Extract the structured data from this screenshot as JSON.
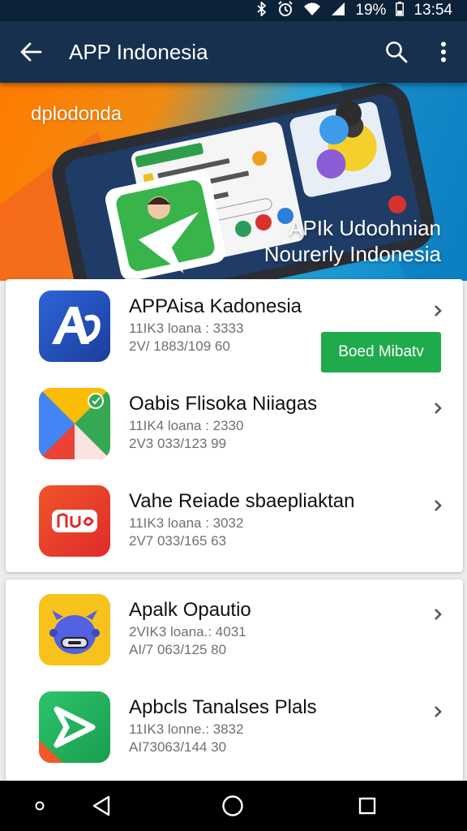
{
  "status_bar": {
    "battery": "19%",
    "time": "13:54",
    "icons": [
      "bluetooth-icon",
      "alarm-icon",
      "wifi-icon",
      "signal-icon",
      "battery-icon"
    ]
  },
  "app_bar": {
    "title": "APP Indonesia",
    "back_icon": "arrow-left-icon",
    "search_icon": "search-icon",
    "menu_icon": "more-vert-icon"
  },
  "banner": {
    "tagline": "dplodonda",
    "headline_line1": "APIk Udoohnian",
    "headline_line2": "Nourerly Indonesia"
  },
  "card1": {
    "apps": [
      {
        "name": "APPAisa Kadonesia",
        "meta1": "11IK3 loana :  3333",
        "meta2": "2V/ 1883/109 60",
        "install_label": "Boed Mibatv",
        "icon": "app-a-icon",
        "colors": [
          "#1b3f9c",
          "#2e63d8"
        ]
      },
      {
        "name": "Oabis Flisoka Niiagas",
        "meta1": "11IK4 loana :  2330",
        "meta2": "2V3 033/123 99",
        "icon": "play-triangle-icon"
      },
      {
        "name": "Vahe Reiade sbaepliaktan",
        "meta1": "11IK3 loana :  3032",
        "meta2": "2V7 033/165 63",
        "icon": "nu-logo-icon",
        "colors": [
          "#f0552a",
          "#e02a2a"
        ]
      }
    ]
  },
  "card2": {
    "apps": [
      {
        "name": "Apalk Opautio",
        "meta1": "2VIK3 loana.:  4031",
        "meta2": "AI/7 063/125 80",
        "icon": "monster-icon",
        "colors": [
          "#f7c21b",
          "#5461e0"
        ]
      },
      {
        "name": "Apbcls Tanalses Plals",
        "meta1": "11IK3 lonne.:  3832",
        "meta2": "AI73063/144 30",
        "icon": "arrow-logo-icon",
        "colors": [
          "#2cc36b",
          "#1a9e4f"
        ]
      }
    ]
  },
  "nav_bar": {
    "icons": [
      "dot-icon",
      "back-triangle-icon",
      "home-circle-icon",
      "recents-square-icon"
    ]
  }
}
